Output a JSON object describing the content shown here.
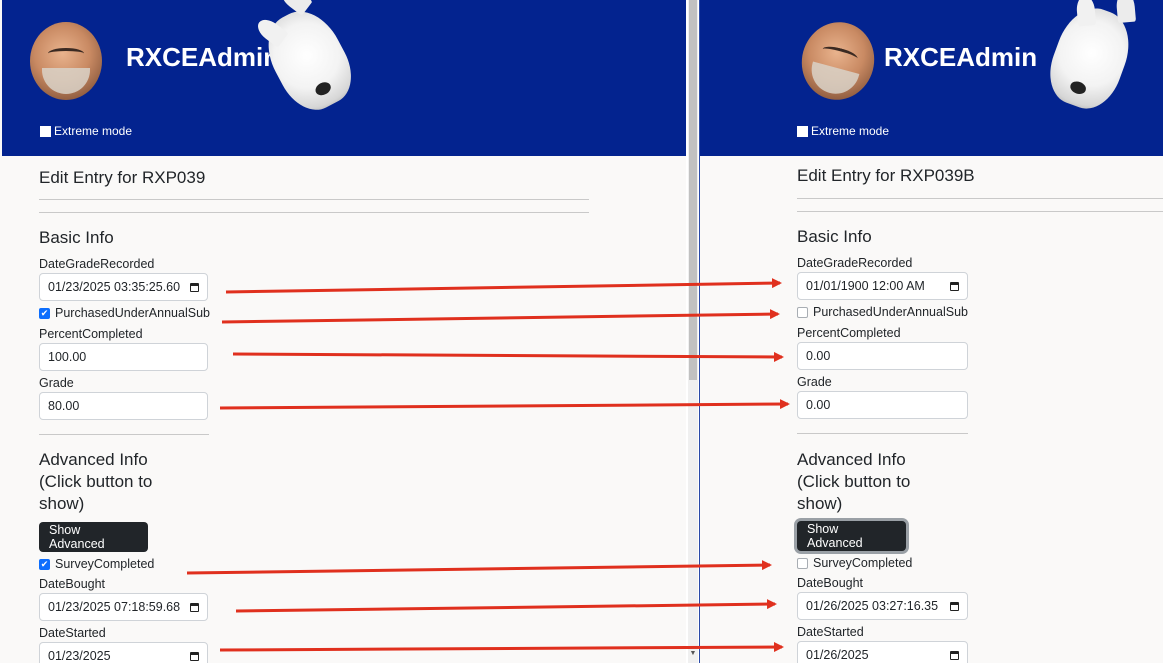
{
  "left": {
    "brand": "RXCEAdmin",
    "extreme_mode_label": "Extreme mode",
    "page_title": "Edit Entry for  RXP039",
    "basic_info_title": "Basic Info",
    "date_grade_recorded": {
      "label": "DateGradeRecorded",
      "value": "01/23/2025 03:35:25.60"
    },
    "purchased_under_annual_sub": {
      "label": "PurchasedUnderAnnualSub",
      "checked": true
    },
    "percent_completed": {
      "label": "PercentCompleted",
      "value": "100.00"
    },
    "grade": {
      "label": "Grade",
      "value": "80.00"
    },
    "advanced_info_title_line1": "Advanced Info",
    "advanced_info_title_line2": "(Click button to",
    "advanced_info_title_line3": "show)",
    "show_advanced_button": "Show Advanced",
    "survey_completed": {
      "label": "SurveyCompleted",
      "checked": true
    },
    "date_bought": {
      "label": "DateBought",
      "value": "01/23/2025 07:18:59.68"
    },
    "date_started": {
      "label": "DateStarted",
      "value": "01/23/2025"
    }
  },
  "right": {
    "brand": "RXCEAdmin",
    "extreme_mode_label": "Extreme mode",
    "page_title": "Edit Entry for RXP039B",
    "basic_info_title": "Basic Info",
    "date_grade_recorded": {
      "label": "DateGradeRecorded",
      "value": "01/01/1900 12:00  AM"
    },
    "purchased_under_annual_sub": {
      "label": "PurchasedUnderAnnualSub",
      "checked": false
    },
    "percent_completed": {
      "label": "PercentCompleted",
      "value": "0.00"
    },
    "grade": {
      "label": "Grade",
      "value": "0.00"
    },
    "advanced_info_title_line1": "Advanced Info",
    "advanced_info_title_line2": "(Click button to",
    "advanced_info_title_line3": "show)",
    "show_advanced_button": "Show Advanced",
    "survey_completed": {
      "label": "SurveyCompleted",
      "checked": false
    },
    "date_bought": {
      "label": "DateBought",
      "value": "01/26/2025 03:27:16.35"
    },
    "date_started": {
      "label": "DateStarted",
      "value": "01/26/2025"
    }
  },
  "colors": {
    "header_bg": "#03238f",
    "checkbox_checked": "#0d6efd",
    "button_dark": "#212529",
    "annotation_arrow": "#e0301e"
  },
  "icons": {
    "calendar": "calendar-icon",
    "checkmark": "✔"
  }
}
